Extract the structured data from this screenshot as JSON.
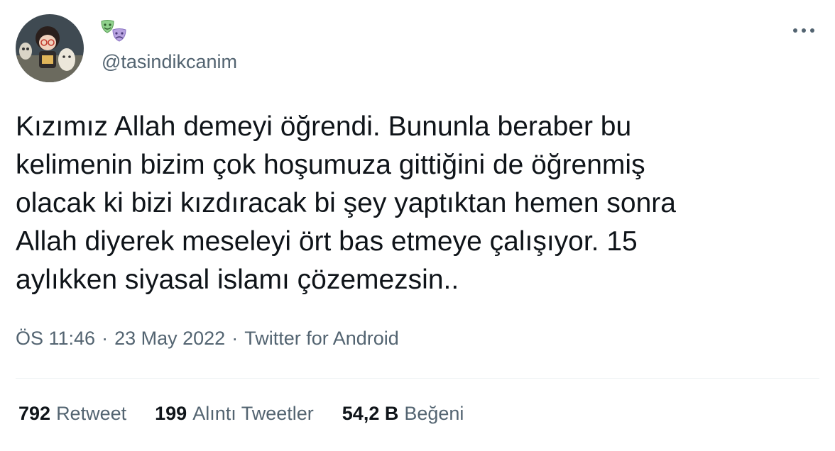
{
  "author": {
    "handle": "@tasindikcanim",
    "name_icons": [
      "happy-theater-mask-icon",
      "sad-theater-mask-icon"
    ],
    "avatar_icon": "avatar"
  },
  "tweet": {
    "text": "Kızımız Allah demeyi öğrendi. Bununla beraber bu\nkelimenin bizim çok hoşumuza gittiğini de öğrenmiş\nolacak ki bizi kızdıracak bi şey yaptıktan hemen sonra\nAllah diyerek meseleyi ört bas etmeye çalışıyor. 15\naylıkken siyasal islamı çözemezsin..",
    "time": "ÖS 11:46",
    "date": "23 May 2022",
    "source": "Twitter for Android",
    "separator": "·"
  },
  "stats": [
    {
      "value": "792",
      "label": "Retweet"
    },
    {
      "value": "199",
      "label": "Alıntı Tweetler"
    },
    {
      "value": "54,2 B",
      "label": "Beğeni"
    }
  ],
  "colors": {
    "text": "#0f1419",
    "secondary": "#536471",
    "divider": "#eff3f4",
    "mask_green": "#8fd18c",
    "mask_purple": "#b8a3e0"
  }
}
